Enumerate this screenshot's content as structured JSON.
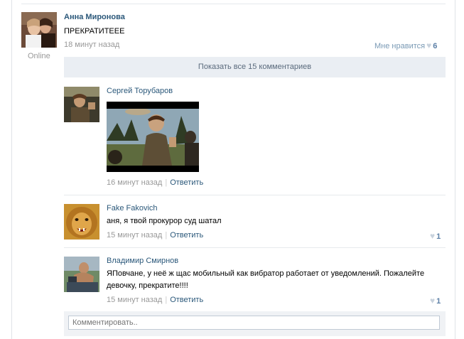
{
  "post": {
    "author": "Анна Миронова",
    "text": "ПРЕКРАТИТЕЕЕ",
    "time": "18 минут назад",
    "status": "Online",
    "like_label": "Мне нравится",
    "like_count": "6"
  },
  "show_all_label": "Показать все 15 комментариев",
  "comments": [
    {
      "author": "Сергей Торубаров",
      "text": "",
      "time": "16 минут назад",
      "reply_label": "Ответить",
      "like_count": ""
    },
    {
      "author": "Fake Fakovich",
      "text": "аня, я твой прокурор суд шатал",
      "time": "15 минут назад",
      "reply_label": "Ответить",
      "like_count": "1"
    },
    {
      "author": "Владимир Смирнов",
      "text_line1": "ЯПовчане, у неё ж щас мобильный как вибратор работает от уведомлений. Пожалейте",
      "text_line2": "девочку, прекратите!!!!",
      "time": "15 минут назад",
      "reply_label": "Ответить",
      "like_count": "1"
    }
  ],
  "comment_input": {
    "placeholder": "Комментировать.."
  },
  "icons": {
    "heart": "heart-icon"
  },
  "colors": {
    "link": "#2b587a",
    "meta": "#999999",
    "button_bg": "#eaeef3"
  }
}
